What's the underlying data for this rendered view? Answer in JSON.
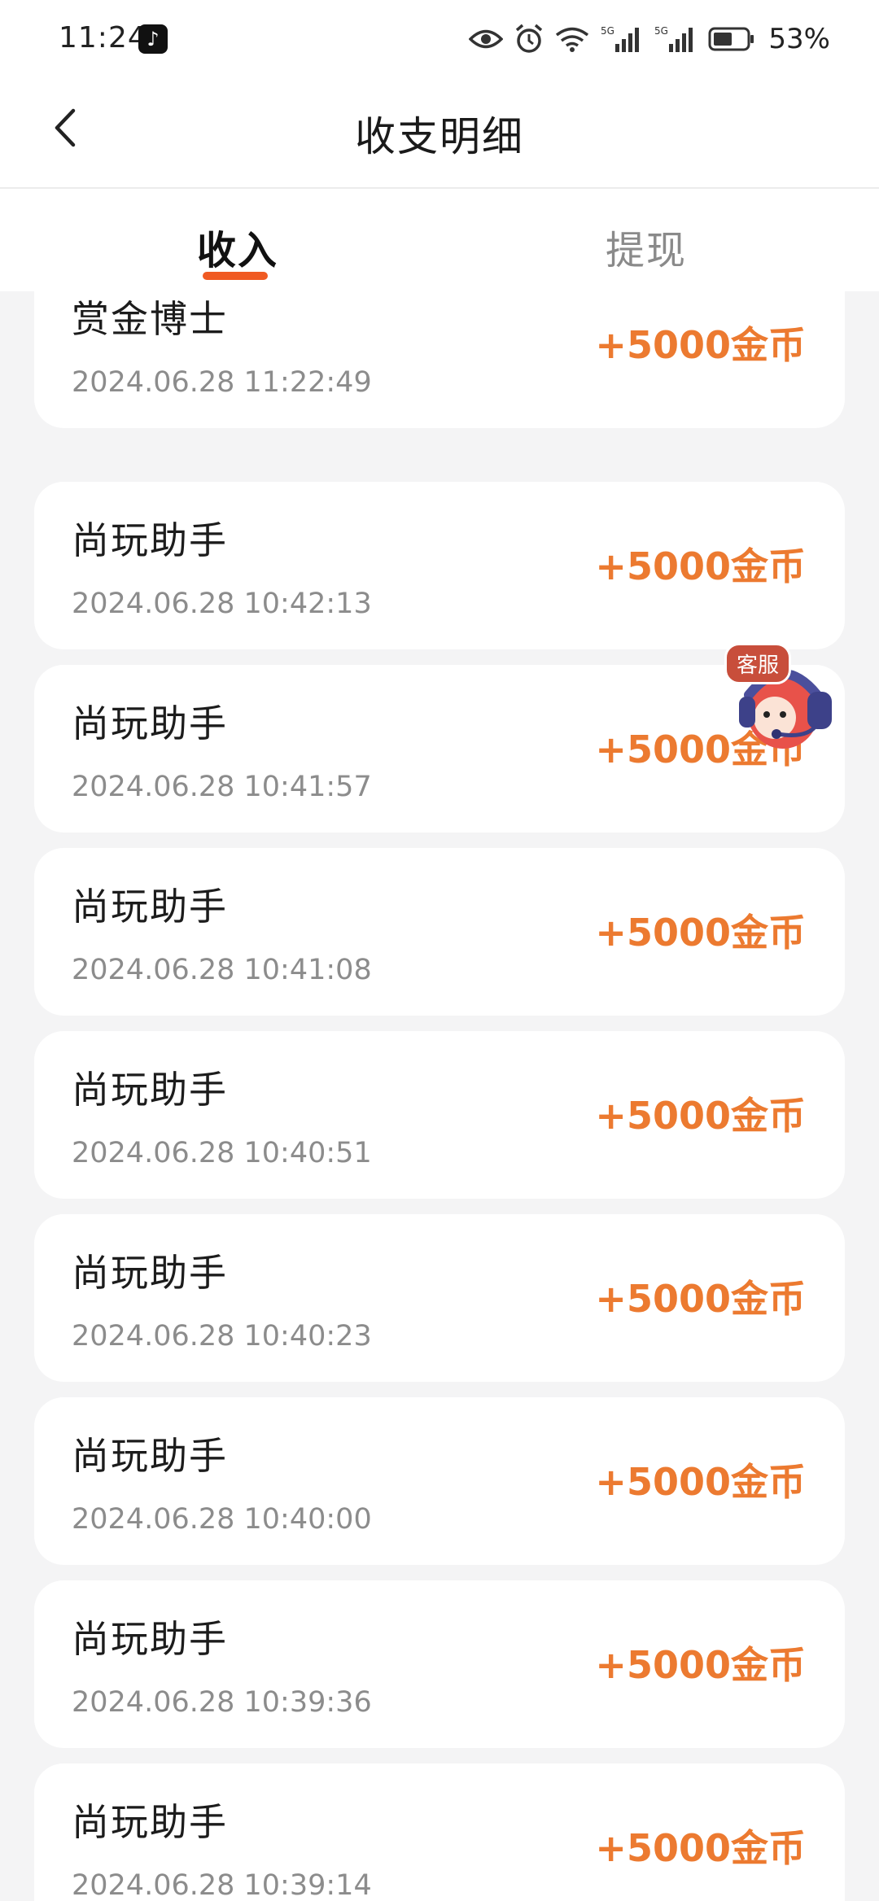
{
  "status_bar": {
    "time": "11:24",
    "battery_percent": "53%",
    "icons": [
      "tiktok-icon",
      "eye-icon",
      "alarm-icon",
      "wifi-icon",
      "signal-5g-icon",
      "signal-5g-icon",
      "battery-icon"
    ],
    "network_label_1": "5G",
    "network_label_2": "5G"
  },
  "header": {
    "title": "收支明细",
    "back_icon": "chevron-left-icon"
  },
  "tabs": [
    {
      "label": "收入",
      "active": true
    },
    {
      "label": "提现",
      "active": false
    }
  ],
  "accent_color": "#f05a22",
  "amount_color": "#ec7a30",
  "records": [
    {
      "name": "赏金博士",
      "time": "2024.06.28 11:22:49",
      "amount": "+5000金币"
    },
    {
      "name": "尚玩助手",
      "time": "2024.06.28 10:42:13",
      "amount": "+5000金币"
    },
    {
      "name": "尚玩助手",
      "time": "2024.06.28 10:41:57",
      "amount": "+5000金币"
    },
    {
      "name": "尚玩助手",
      "time": "2024.06.28 10:41:08",
      "amount": "+5000金币"
    },
    {
      "name": "尚玩助手",
      "time": "2024.06.28 10:40:51",
      "amount": "+5000金币"
    },
    {
      "name": "尚玩助手",
      "time": "2024.06.28 10:40:23",
      "amount": "+5000金币"
    },
    {
      "name": "尚玩助手",
      "time": "2024.06.28 10:40:00",
      "amount": "+5000金币"
    },
    {
      "name": "尚玩助手",
      "time": "2024.06.28 10:39:36",
      "amount": "+5000金币"
    },
    {
      "name": "尚玩助手",
      "time": "2024.06.28 10:39:14",
      "amount": "+5000金币"
    }
  ],
  "customer_service": {
    "label": "客服",
    "icon": "headset-mascot-icon"
  }
}
